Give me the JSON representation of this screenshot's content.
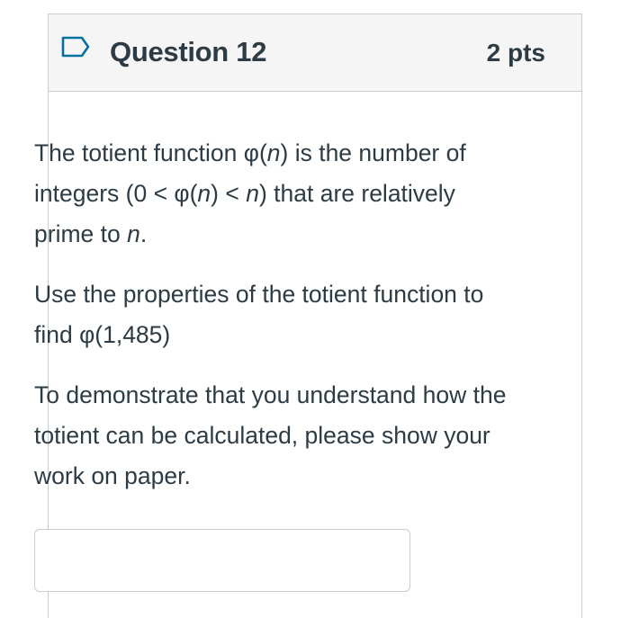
{
  "question": {
    "title": "Question 12",
    "points": "2 pts",
    "flag_icon": "flag-icon",
    "flag_color": "#0770a3"
  },
  "body": {
    "paragraph_1": {
      "s1": "The totient function φ(",
      "s2": "n",
      "s3": ") is the number of integers (0 < φ(",
      "s4": "n",
      "s5": ") < ",
      "s6": "n",
      "s7": ") that are relatively prime to ",
      "s8": "n",
      "s9": "."
    },
    "paragraph_2": "Use the properties of the totient function to find φ(1,485)",
    "paragraph_3": "To demonstrate that you understand how the totient can be calculated, please show your work on paper."
  },
  "answer": {
    "value": "",
    "placeholder": ""
  }
}
